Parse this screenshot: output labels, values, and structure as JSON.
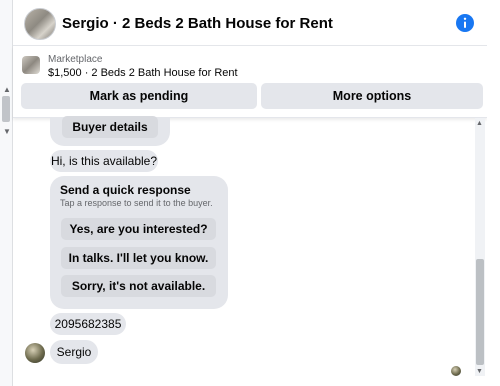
{
  "header": {
    "title": "Sergio · 2 Beds 2 Bath House for Rent",
    "info_icon": "info-icon"
  },
  "listing": {
    "source": "Marketplace",
    "description": "$1,500 · 2 Beds 2 Bath House for Rent",
    "buttons": {
      "mark_pending": "Mark as pending",
      "more_options": "More options"
    }
  },
  "messages": {
    "buyer_details": "Buyer details",
    "greeting": "Hi, is this available?",
    "quick_response": {
      "title": "Send a quick response",
      "subtitle": "Tap a response to send it to the buyer.",
      "options": [
        "Yes, are you interested?",
        "In talks. I'll let you know.",
        "Sorry, it's not available."
      ]
    },
    "phone": "2095682385",
    "name": "Sergio"
  },
  "colors": {
    "accent": "#1877f2",
    "bubble": "#e4e6eb",
    "secondary_text": "#65676b"
  }
}
